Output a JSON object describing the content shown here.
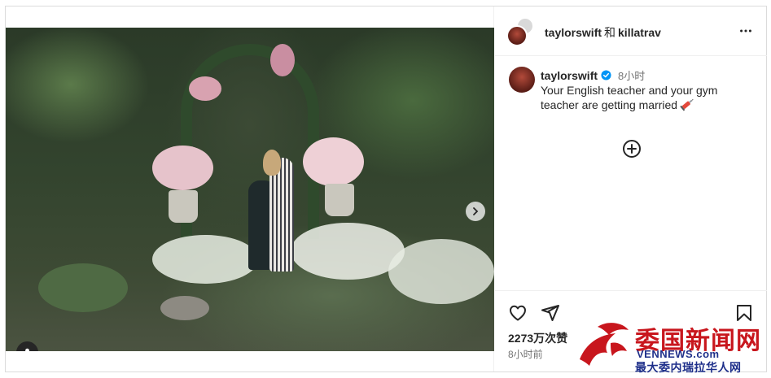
{
  "post": {
    "header": {
      "user1": "taylorswift",
      "conj": "和",
      "user2": "killatrav"
    },
    "caption": {
      "username": "taylorswift",
      "time": "8小时",
      "text": "Your English teacher and your gym teacher are getting married"
    },
    "likes": "2273万次赞",
    "ago": "8小时前"
  },
  "icons": {
    "more": "more-horizontal-icon",
    "add": "add-circle-icon",
    "like": "heart-icon",
    "share": "send-icon",
    "save": "bookmark-icon",
    "next": "chevron-right-icon",
    "tag": "user-tag-icon",
    "verified": "verified-badge-icon",
    "emoji": "syringe-emoji"
  },
  "watermark": {
    "title_a": "委国",
    "title_b": "新闻网",
    "url": "VENNEWS.com",
    "subtitle": "最大委内瑞拉华人网"
  },
  "colors": {
    "verified": "#0095f6",
    "watermark_red": "#c8161d",
    "watermark_blue": "#1e2f8a"
  }
}
